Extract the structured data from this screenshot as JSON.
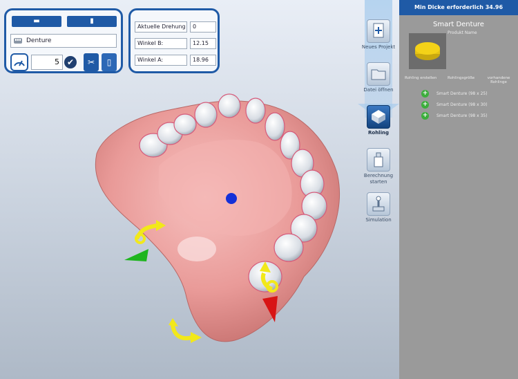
{
  "panel_left": {
    "dropdown_value": "Denture",
    "spinner_value": "5"
  },
  "panel_mid": {
    "rows": [
      {
        "label": "Aktuelle Drehung",
        "value": "0"
      },
      {
        "label": "Winkel B:",
        "value": "12.15"
      },
      {
        "label": "Winkel A:",
        "value": "18.96"
      }
    ]
  },
  "toolbar": {
    "items": [
      {
        "label": "Neues Projekt",
        "icon": "new-project-icon"
      },
      {
        "label": "Datei öffnen",
        "icon": "open-file-icon"
      },
      {
        "label": "Rohling",
        "icon": "blank-icon",
        "active": true
      },
      {
        "label": "Berechnung starten",
        "icon": "calculation-icon"
      },
      {
        "label": "Simulation",
        "icon": "simulation-icon"
      }
    ]
  },
  "right_panel": {
    "header": "Min Dicke erforderlich 34.96",
    "title": "Smart Denture",
    "product_name": "Produkt Name",
    "columns": [
      "Rohling erstellen",
      "Rohlingsgröße",
      "vorhandene Rohlinge"
    ],
    "options": [
      "Smart Denture (98 x 25)",
      "Smart Denture (98 x 30)",
      "Smart Denture (98 x 35)"
    ],
    "preview_color": "#f4d218"
  },
  "colors": {
    "accent": "#1f5aa6",
    "gum": "#e99a98",
    "teeth": "#e6e9ee"
  }
}
